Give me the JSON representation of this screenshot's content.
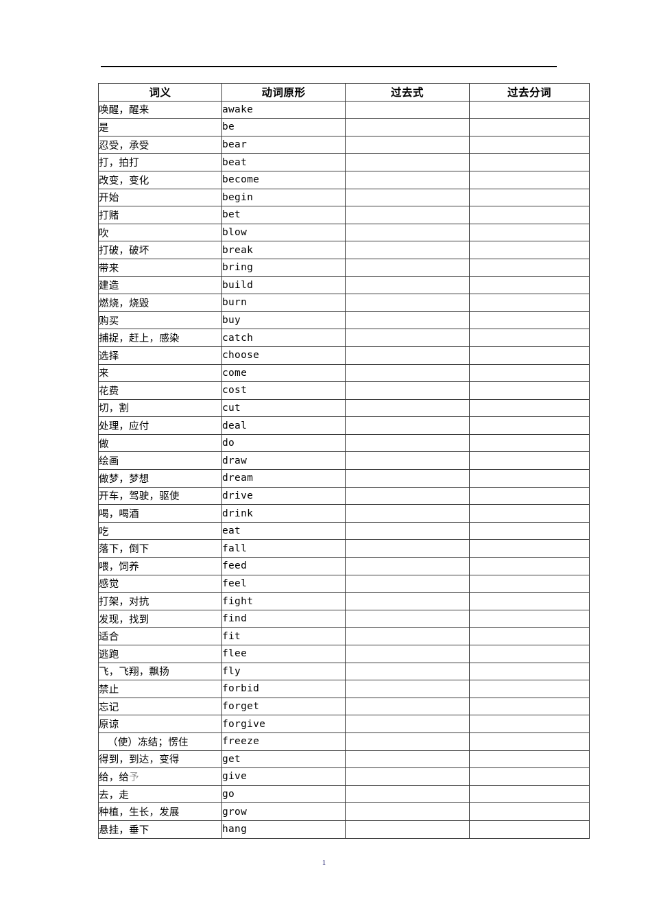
{
  "document": {
    "page_number": "1"
  },
  "table": {
    "headers": {
      "meaning": "词义",
      "base_form": "动词原形",
      "past_tense": "过去式",
      "past_participle": "过去分词"
    },
    "rows": [
      {
        "meaning": "唤醒，醒来",
        "base": "awake"
      },
      {
        "meaning": "是",
        "base": "be"
      },
      {
        "meaning": "忍受，承受",
        "base": "bear"
      },
      {
        "meaning": "打，拍打",
        "base": "beat"
      },
      {
        "meaning": "改变，变化",
        "base": "become"
      },
      {
        "meaning": "开始",
        "base": "begin"
      },
      {
        "meaning": "打赌",
        "base": "bet"
      },
      {
        "meaning": "吹",
        "base": "blow"
      },
      {
        "meaning": "打破，破坏",
        "base": "break"
      },
      {
        "meaning": "带来",
        "base": "bring"
      },
      {
        "meaning": "建造",
        "base": "build"
      },
      {
        "meaning": "燃烧，烧毁",
        "base": "burn"
      },
      {
        "meaning": "购买",
        "base": "buy"
      },
      {
        "meaning": "捕捉，赶上，感染",
        "base": "catch"
      },
      {
        "meaning": "选择",
        "base": "choose"
      },
      {
        "meaning": "来",
        "base": "come"
      },
      {
        "meaning": "花费",
        "base": "cost"
      },
      {
        "meaning": "切，割",
        "base": "cut"
      },
      {
        "meaning": "处理，应付",
        "base": "deal"
      },
      {
        "meaning": "做",
        "base": "do"
      },
      {
        "meaning": "绘画",
        "base": "draw"
      },
      {
        "meaning": "做梦，梦想",
        "base": "dream"
      },
      {
        "meaning": "开车，驾驶，驱使",
        "base": "drive"
      },
      {
        "meaning": "喝，喝酒",
        "base": "drink"
      },
      {
        "meaning": "吃",
        "base": "eat"
      },
      {
        "meaning": "落下，倒下",
        "base": "fall"
      },
      {
        "meaning": "喂，饲养",
        "base": "feed"
      },
      {
        "meaning": "感觉",
        "base": "feel"
      },
      {
        "meaning": "打架，对抗",
        "base": "fight"
      },
      {
        "meaning": "发现，找到",
        "base": "find"
      },
      {
        "meaning": "适合",
        "base": "fit"
      },
      {
        "meaning": "逃跑",
        "base": "flee"
      },
      {
        "meaning": "飞，飞翔，飘扬",
        "base": "fly"
      },
      {
        "meaning": "禁止",
        "base": "forbid"
      },
      {
        "meaning": "忘记",
        "base": "forget"
      },
      {
        "meaning": "原谅",
        "base": "forgive"
      },
      {
        "meaning": "（使）冻结；愣住",
        "base": "freeze",
        "indented": true
      },
      {
        "meaning": "得到，到达，变得",
        "base": "get"
      },
      {
        "meaning": "给，给",
        "meaning_faded": "予",
        "base": "give"
      },
      {
        "meaning": "去，走",
        "base": "go"
      },
      {
        "meaning": "种植，生长，发展",
        "base": "grow"
      },
      {
        "meaning": "悬挂，垂下",
        "base": "hang"
      }
    ]
  }
}
